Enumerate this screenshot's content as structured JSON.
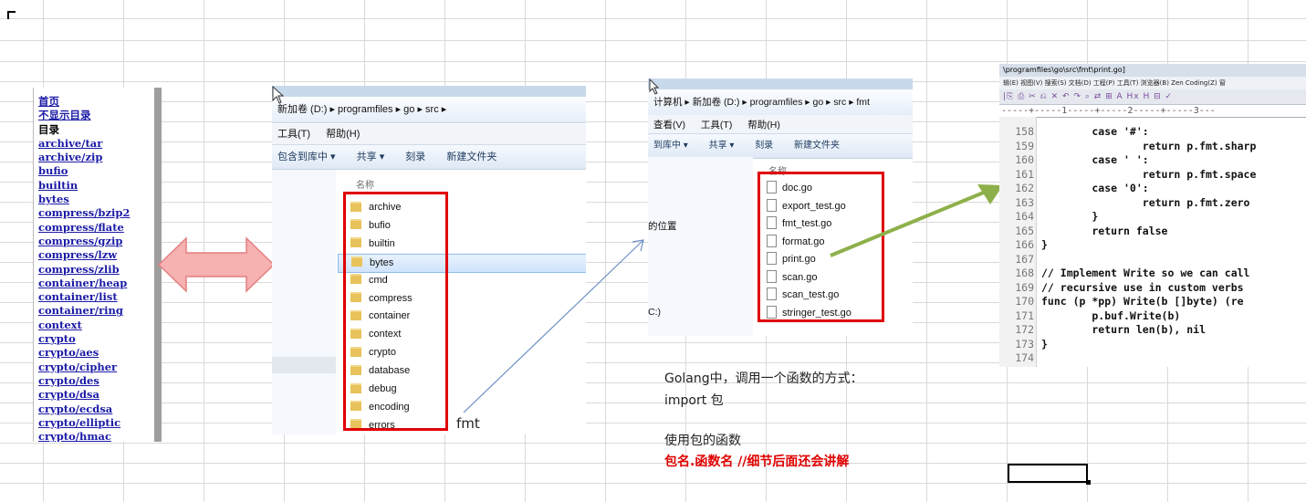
{
  "packages": {
    "items": [
      {
        "label": "首页",
        "link": true
      },
      {
        "label": "不显示目录",
        "link": true
      },
      {
        "label": "目录",
        "link": false
      },
      {
        "label": "archive/tar",
        "link": true
      },
      {
        "label": "archive/zip",
        "link": true
      },
      {
        "label": "bufio",
        "link": true
      },
      {
        "label": "builtin",
        "link": true
      },
      {
        "label": "bytes",
        "link": true
      },
      {
        "label": "compress/bzip2",
        "link": true
      },
      {
        "label": "compress/flate",
        "link": true
      },
      {
        "label": "compress/gzip",
        "link": true
      },
      {
        "label": "compress/lzw",
        "link": true
      },
      {
        "label": "compress/zlib",
        "link": true
      },
      {
        "label": "container/heap",
        "link": true
      },
      {
        "label": "container/list",
        "link": true
      },
      {
        "label": "container/ring",
        "link": true
      },
      {
        "label": "context",
        "link": true
      },
      {
        "label": "crypto",
        "link": true
      },
      {
        "label": "crypto/aes",
        "link": true
      },
      {
        "label": "crypto/cipher",
        "link": true
      },
      {
        "label": "crypto/des",
        "link": true
      },
      {
        "label": "crypto/dsa",
        "link": true
      },
      {
        "label": "crypto/ecdsa",
        "link": true
      },
      {
        "label": "crypto/elliptic",
        "link": true
      },
      {
        "label": "crypto/hmac",
        "link": true
      }
    ]
  },
  "explorer_src": {
    "address": "新加卷 (D:) ▸ programfiles ▸ go ▸ src ▸",
    "menu": [
      "工具(T)",
      "帮助(H)"
    ],
    "toolbar": [
      "包含到库中 ▾",
      "共享 ▾",
      "刻录",
      "新建文件夹"
    ],
    "column_name": "名称",
    "folders": [
      "archive",
      "bufio",
      "builtin",
      "bytes",
      "cmd",
      "compress",
      "container",
      "context",
      "crypto",
      "database",
      "debug",
      "encoding",
      "errors"
    ],
    "selected_folder": "bytes"
  },
  "explorer_fmt": {
    "address": "计算机 ▸ 新加卷 (D:) ▸ programfiles ▸ go ▸ src ▸ fmt",
    "menu": [
      "查看(V)",
      "工具(T)",
      "帮助(H)"
    ],
    "toolbar": [
      "到库中 ▾",
      "共享 ▾",
      "刻录",
      "新建文件夹"
    ],
    "column_name": "名称",
    "nav_location": "的位置",
    "nav_drive": "C:)",
    "files": [
      "doc.go",
      "export_test.go",
      "fmt_test.go",
      "format.go",
      "print.go",
      "scan.go",
      "scan_test.go",
      "stringer_test.go"
    ]
  },
  "editor": {
    "title": "\\programfiles\\go\\src\\fmt\\print.go]",
    "menu": "辑(E)  视图(V)  搜索(S)  文档(D)  工程(P)  工具(T)  浏览器(B)  Zen Coding(Z)  窗",
    "toolbar": "|⎘ ⎙ ✂ ⎌ ✕ ↶ ↷ ⌕ ⇄ ⊞ A Hx H ⊟ ✓",
    "ruler": "-----+-----1-----+-----2-----+-----3---",
    "lines": [
      {
        "n": "158",
        "code": "        case '#':"
      },
      {
        "n": "159",
        "code": "                return p.fmt.sharp"
      },
      {
        "n": "160",
        "code": "        case ' ':"
      },
      {
        "n": "161",
        "code": "                return p.fmt.space"
      },
      {
        "n": "162",
        "code": "        case '0':"
      },
      {
        "n": "163",
        "code": "                return p.fmt.zero"
      },
      {
        "n": "164",
        "code": "        }"
      },
      {
        "n": "165",
        "code": "        return false"
      },
      {
        "n": "166",
        "code": "}"
      },
      {
        "n": "167",
        "code": ""
      },
      {
        "n": "168",
        "code": "// Implement Write so we can call"
      },
      {
        "n": "169",
        "code": "// recursive use in custom verbs"
      },
      {
        "n": "170",
        "code": "func (p *pp) Write(b []byte) (re"
      },
      {
        "n": "171",
        "code": "        p.buf.Write(b)"
      },
      {
        "n": "172",
        "code": "        return len(b), nil"
      },
      {
        "n": "173",
        "code": "}"
      },
      {
        "n": "174",
        "code": ""
      }
    ]
  },
  "labels": {
    "fmt_arrow_label": "fmt"
  },
  "notes": {
    "line1": "Golang中，调用一个函数的方式：",
    "line2": "import 包",
    "line3": "使用包的函数",
    "line4": "包名.函数名 //细节后面还会讲解"
  },
  "colors": {
    "highlight_red": "#e00000",
    "link_blue": "#1a1aa6",
    "arrow_green": "#8db04a",
    "arrow_pink": "#f6b1b1"
  }
}
